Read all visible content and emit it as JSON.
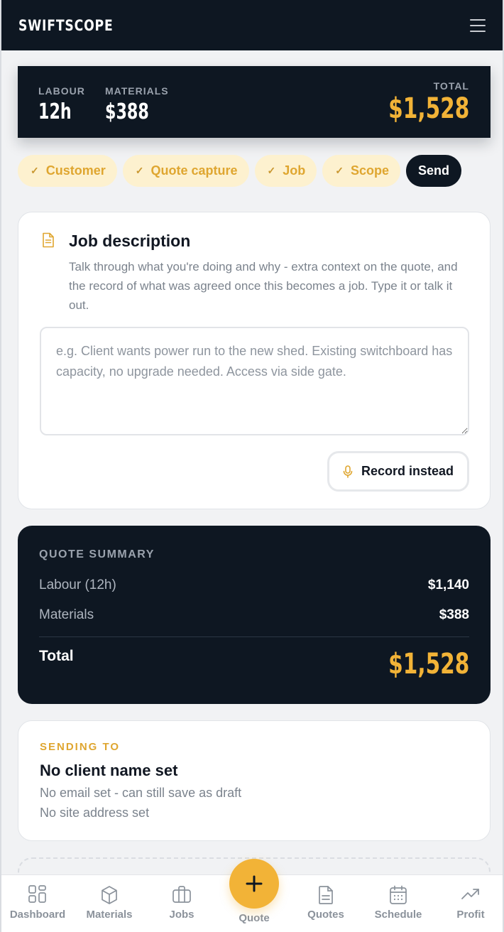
{
  "header": {
    "brand": "SWIFTSCOPE",
    "menu_icon": "hamburger-menu-icon"
  },
  "totals": {
    "labour_label": "LABOUR",
    "labour_value": "12h",
    "materials_label": "MATERIALS",
    "materials_value": "$388",
    "total_label": "TOTAL",
    "total_value": "$1,528"
  },
  "steps": [
    {
      "label": "Customer",
      "done": true
    },
    {
      "label": "Quote capture",
      "done": true
    },
    {
      "label": "Job",
      "done": true
    },
    {
      "label": "Scope",
      "done": true
    },
    {
      "label": "Send",
      "done": false,
      "active": true
    }
  ],
  "job_description": {
    "title": "Job description",
    "help_text": "Talk through what you're doing and why - extra context on the quote, and the record of what was agreed once this becomes a job. Type it or talk it out.",
    "input_value": "",
    "placeholder": "e.g. Client wants power run to the new shed. Existing switchboard has capacity, no upgrade needed. Access via side gate.",
    "record_button": "Record instead"
  },
  "quote_summary": {
    "heading": "QUOTE SUMMARY",
    "rows": [
      {
        "label": "Labour (12h)",
        "value": "$1,140"
      },
      {
        "label": "Materials",
        "value": "$388"
      }
    ],
    "total_label": "Total",
    "total_value": "$1,528"
  },
  "sending_to": {
    "label": "SENDING TO",
    "name": "No client name set",
    "email_note": "No email set - can still save as draft",
    "address_note": "No site address set"
  },
  "bottom_nav": {
    "items": [
      {
        "label": "Dashboard",
        "icon": "dashboard-grid-icon"
      },
      {
        "label": "Materials",
        "icon": "box-icon"
      },
      {
        "label": "Jobs",
        "icon": "briefcase-icon"
      },
      {
        "label": "Quote",
        "icon": "plus-icon"
      },
      {
        "label": "Quotes",
        "icon": "document-icon"
      },
      {
        "label": "Schedule",
        "icon": "calendar-icon"
      },
      {
        "label": "Profit",
        "icon": "trending-up-icon"
      }
    ]
  },
  "colors": {
    "navy": "#0e1722",
    "accent": "#f2b337",
    "chip_bg": "#fdf1cf",
    "chip_text": "#dfa630",
    "muted": "#7b838d",
    "background": "#f1f2f4"
  }
}
